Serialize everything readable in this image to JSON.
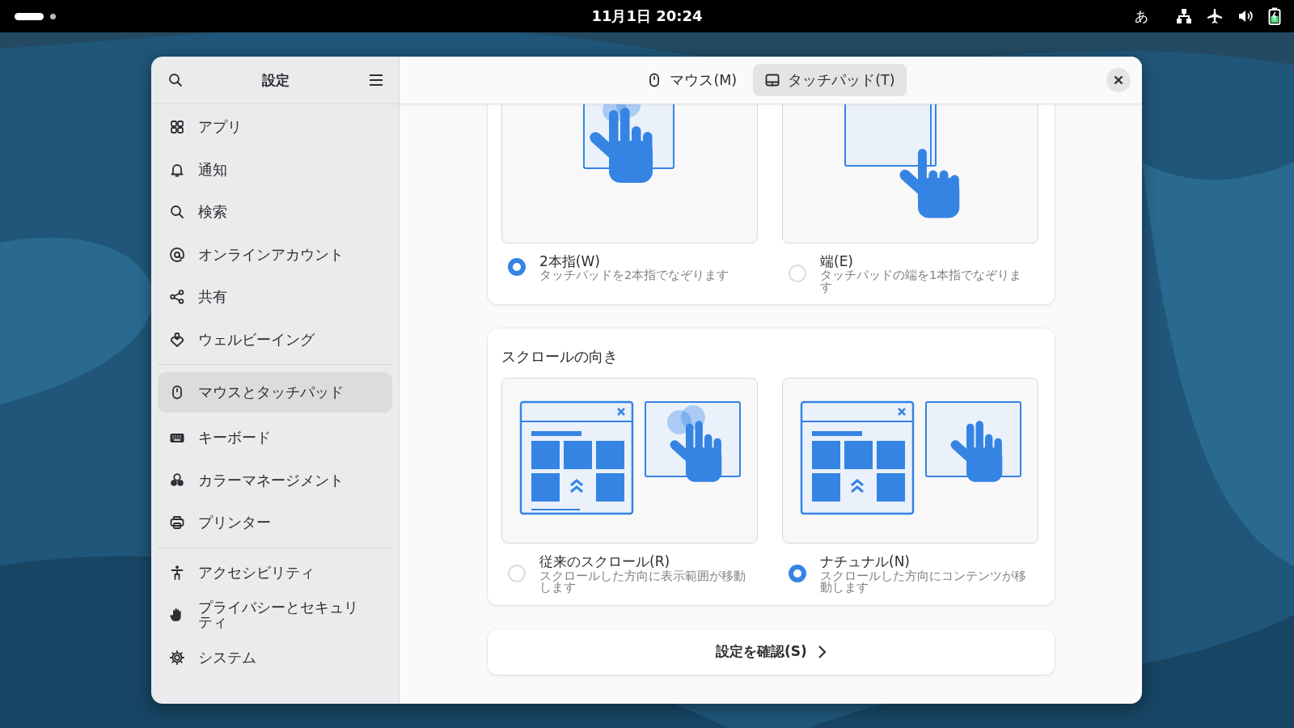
{
  "top_bar": {
    "clock": "11月1日  20:24",
    "input_method": "あ"
  },
  "window": {
    "title": "設定"
  },
  "tabs": [
    {
      "label": "マウス(M)",
      "kind": "mouse",
      "selected": false
    },
    {
      "label": "タッチパッド(T)",
      "kind": "touchpad",
      "selected": true
    }
  ],
  "sidebar": {
    "sections": [
      {
        "items": [
          {
            "label": "アプリ",
            "kind": "apps",
            "selected": false
          },
          {
            "label": "通知",
            "kind": "bell",
            "selected": false
          },
          {
            "label": "検索",
            "kind": "search",
            "selected": false
          },
          {
            "label": "オンラインアカウント",
            "kind": "at",
            "selected": false
          },
          {
            "label": "共有",
            "kind": "share",
            "selected": false
          },
          {
            "label": "ウェルビーイング",
            "kind": "wellbeing",
            "selected": false
          }
        ]
      },
      {
        "items": [
          {
            "label": "マウスとタッチパッド",
            "kind": "mouse",
            "selected": true
          },
          {
            "label": "キーボード",
            "kind": "keyboard",
            "selected": false
          },
          {
            "label": "カラーマネージメント",
            "kind": "color",
            "selected": false
          },
          {
            "label": "プリンター",
            "kind": "printer",
            "selected": false
          }
        ]
      },
      {
        "items": [
          {
            "label": "アクセシビリティ",
            "kind": "accessibility",
            "selected": false
          },
          {
            "label": "プライバシーとセキュリティ",
            "kind": "hand",
            "selected": false
          },
          {
            "label": "システム",
            "kind": "gear",
            "selected": false
          }
        ]
      }
    ]
  },
  "scroll_method": {
    "options": [
      {
        "kind": "two-finger",
        "label": "2本指(W)",
        "description": "タッチパッドを2本指でなぞります",
        "selected": true
      },
      {
        "kind": "edge",
        "label": "端(E)",
        "description": "タッチパッドの端を1本指でなぞります",
        "selected": false
      }
    ]
  },
  "scroll_direction": {
    "title": "スクロールの向き",
    "options": [
      {
        "kind": "traditional",
        "label": "従来のスクロール(R)",
        "description": "スクロールした方向に表示範囲が移動します",
        "selected": false
      },
      {
        "kind": "natural",
        "label": "ナチュナル(N)",
        "description": "スクロールした方向にコンテンツが移動します",
        "selected": true
      }
    ]
  },
  "test_button": {
    "label": "設定を確認(S)"
  }
}
